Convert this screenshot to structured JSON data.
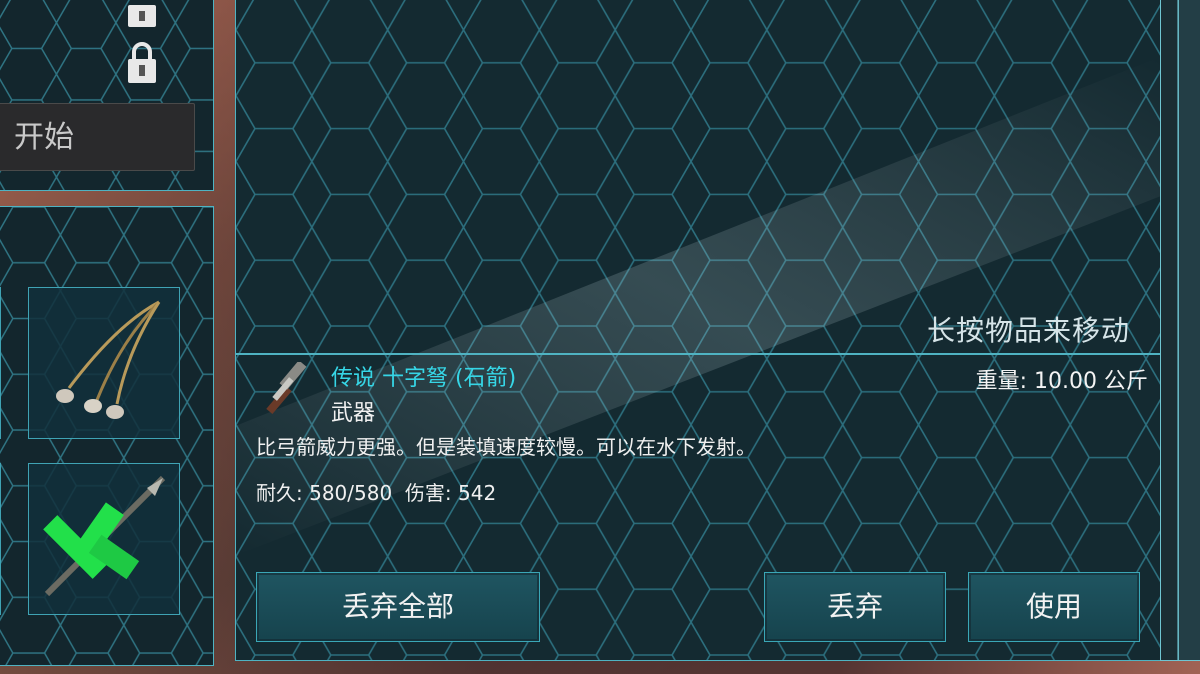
{
  "top_left": {
    "start_label": "开始"
  },
  "main": {
    "hint": "长按物品来移动",
    "item": {
      "name": "传说 十字弩 (石箭)",
      "type": "武器",
      "weight": "重量: 10.00 公斤",
      "description": "比弓箭威力更强。但是装填速度较慢。可以在水下发射。",
      "durability_label": "耐久:",
      "durability": "580/580",
      "damage_label": "伤害:",
      "damage": "542",
      "name_color": "#36d6e6"
    },
    "buttons": {
      "drop_all": "丢弃全部",
      "drop": "丢弃",
      "use": "使用"
    }
  },
  "inventory": {
    "slots": [
      {
        "icon": "bola-icon"
      },
      {
        "icon": "spear-and-hammer-icon"
      }
    ]
  },
  "colors": {
    "accent": "#4fb3c2",
    "button_bg": "#1f5561",
    "highlight_green": "#22e04a"
  }
}
